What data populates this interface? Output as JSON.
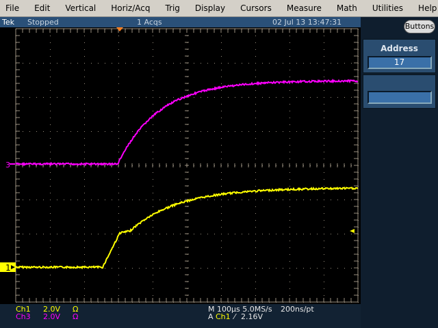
{
  "menu": [
    "File",
    "Edit",
    "Vertical",
    "Horiz/Acq",
    "Trig",
    "Display",
    "Cursors",
    "Measure",
    "Math",
    "Utilities",
    "Help"
  ],
  "status": {
    "brand": "Tek",
    "state": "Stopped",
    "acqs": "1 Acqs",
    "datetime": "02 Jul 13 13:47:31"
  },
  "side": {
    "buttons_label": "Buttons",
    "panel_title": "Address",
    "panel_value": "17",
    "panel2_value": ""
  },
  "markers": {
    "ch3": "3",
    "ch1": "1"
  },
  "readout": {
    "ch1_label": "Ch1",
    "ch1_scale": "2.0V",
    "ch1_coupling": "Ω",
    "ch3_label": "Ch3",
    "ch3_scale": "2.0V",
    "ch3_coupling": "Ω",
    "timebase": "M 100µs 5.0MS/s",
    "record": "200ns/pt",
    "trig_prefix": "A",
    "trig_source": "Ch1",
    "trig_slope": "⁄",
    "trig_level": "2.16V"
  },
  "colors": {
    "ch1": "#ffff00",
    "ch3": "#ff00ff",
    "trigger": "#ff8020"
  }
}
